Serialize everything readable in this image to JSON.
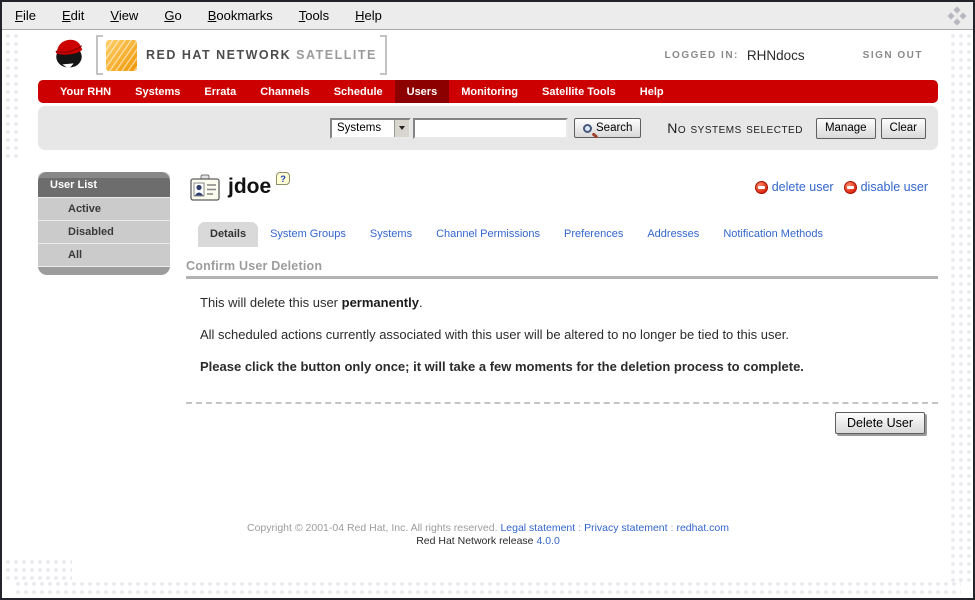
{
  "window": {
    "menu": [
      "File",
      "Edit",
      "View",
      "Go",
      "Bookmarks",
      "Tools",
      "Help"
    ]
  },
  "header": {
    "brand_name": "RED HAT NETWORK",
    "brand_product": "SATELLITE",
    "logged_in_label": "LOGGED IN:",
    "username": "RHNdocs",
    "sign_out_label": "SIGN OUT"
  },
  "nav": {
    "items": [
      {
        "label": "Your RHN",
        "active": false
      },
      {
        "label": "Systems",
        "active": false
      },
      {
        "label": "Errata",
        "active": false
      },
      {
        "label": "Channels",
        "active": false
      },
      {
        "label": "Schedule",
        "active": false
      },
      {
        "label": "Users",
        "active": true
      },
      {
        "label": "Monitoring",
        "active": false
      },
      {
        "label": "Satellite Tools",
        "active": false
      },
      {
        "label": "Help",
        "active": false
      }
    ]
  },
  "searchbar": {
    "category_value": "Systems",
    "query_value": "",
    "search_button": "Search",
    "status_text": "No systems selected",
    "manage_button": "Manage",
    "clear_button": "Clear"
  },
  "sidebar": {
    "title": "User List",
    "items": [
      "Active",
      "Disabled",
      "All"
    ]
  },
  "content": {
    "page_title": "jdoe",
    "help_glyph": "?",
    "actions": [
      {
        "label": "delete user"
      },
      {
        "label": "disable user"
      }
    ],
    "tabs": [
      {
        "label": "Details",
        "active": true
      },
      {
        "label": "System Groups",
        "active": false
      },
      {
        "label": "Systems",
        "active": false
      },
      {
        "label": "Channel Permissions",
        "active": false
      },
      {
        "label": "Preferences",
        "active": false
      },
      {
        "label": "Addresses",
        "active": false
      },
      {
        "label": "Notification Methods",
        "active": false
      }
    ],
    "section_heading": "Confirm User Deletion",
    "para1_prefix": "This will delete this user ",
    "para1_bold": "permanently",
    "para1_suffix": ".",
    "para2": "All scheduled actions currently associated with this user will be altered to no longer be tied to this user.",
    "para3": "Please click the button only once; it will take a few moments for the deletion process to complete.",
    "delete_button": "Delete User"
  },
  "footer": {
    "copyright": "Copyright © 2001-04 Red Hat, Inc. All rights reserved.",
    "links": [
      "Legal statement",
      "Privacy statement",
      "redhat.com"
    ],
    "separator": ":",
    "release_label": "Red Hat Network release",
    "release_version": "4.0.0"
  },
  "colors": {
    "brand_red": "#cc0000",
    "nav_active_red": "#8d0000",
    "link_blue": "#3366cc"
  }
}
